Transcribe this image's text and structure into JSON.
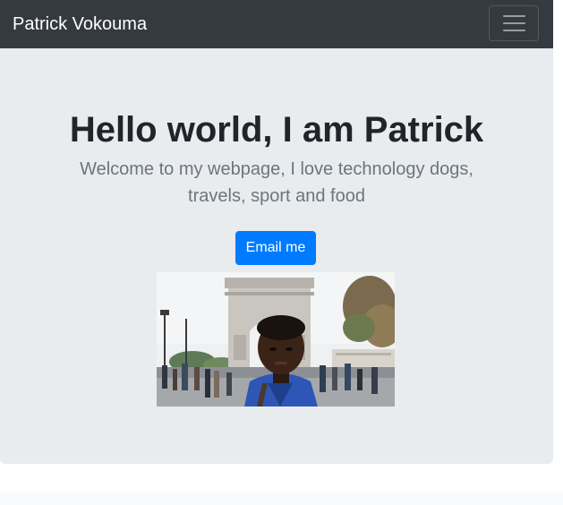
{
  "navbar": {
    "brand": "Patrick Vokouma",
    "toggler_icon": "hamburger-menu-icon"
  },
  "hero": {
    "title": "Hello world, I am Patrick",
    "lead": "Welcome to my webpage, I love technology dogs, travels, sport and food",
    "email_button_label": "Email me"
  },
  "photo": {
    "subject": "selfie-in-front-of-arc-de-triomphe"
  },
  "colors": {
    "navbar_bg": "#343a40",
    "jumbotron_bg": "#e9ecef",
    "primary_button": "#007bff",
    "lead_text": "#6c757d"
  }
}
